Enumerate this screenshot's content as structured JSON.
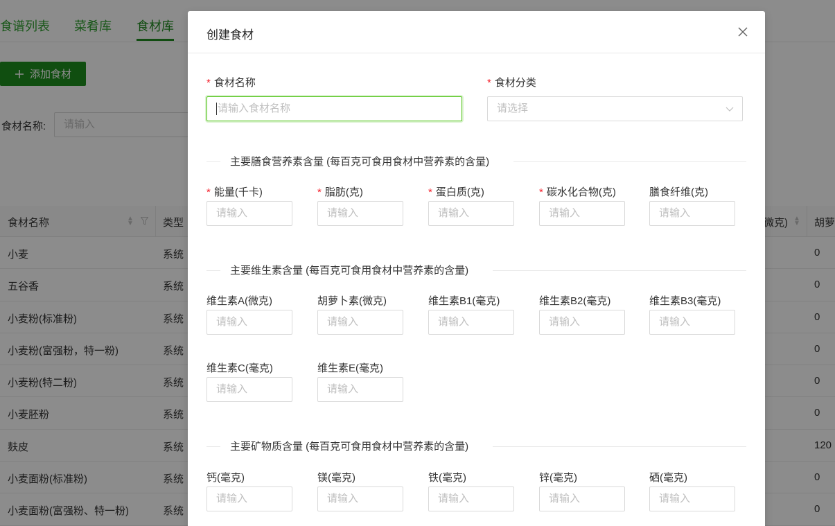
{
  "tabs": [
    {
      "label": "食谱列表"
    },
    {
      "label": "菜肴库"
    },
    {
      "label": "食材库"
    }
  ],
  "toolbar": {
    "add_label": "添加食材",
    "add_icon": "plus-icon"
  },
  "search": {
    "label": "食材名称:",
    "placeholder": "请输入"
  },
  "table": {
    "col_name": "食材名称",
    "col_type": "类型",
    "col_right_partial": "微克)",
    "col_far_right": "胡萝",
    "rows": [
      {
        "name": "小麦",
        "type": "系统",
        "right": "0"
      },
      {
        "name": "五谷香",
        "type": "系统",
        "right": "0"
      },
      {
        "name": "小麦粉(标准粉)",
        "type": "系统",
        "right": "0"
      },
      {
        "name": "小麦粉(富强粉，特一粉)",
        "type": "系统",
        "right": "0"
      },
      {
        "name": "小麦粉(特二粉)",
        "type": "系统",
        "right": "0"
      },
      {
        "name": "小麦胚粉",
        "type": "系统",
        "right": "0"
      },
      {
        "name": "麸皮",
        "type": "系统",
        "right": "120"
      },
      {
        "name": "小麦面粉(标准粉)",
        "type": "系统",
        "right": "0"
      },
      {
        "name": "小麦面粉(富强粉、特一粉)",
        "type": "系统",
        "right": "0"
      }
    ]
  },
  "modal": {
    "title": "创建食材",
    "name_label": "食材名称",
    "name_placeholder": "请输入食材名称",
    "category_label": "食材分类",
    "category_placeholder": "请选择",
    "section1": "主要膳食营养素含量 (每百克可食用食材中营养素的含量)",
    "section2": "主要维生素含量 (每百克可食用食材中营养素的含量)",
    "section3": "主要矿物质含量 (每百克可食用食材中营养素的含量)",
    "input_placeholder": "请输入",
    "macros": [
      {
        "label": "能量(千卡)",
        "required": true
      },
      {
        "label": "脂肪(克)",
        "required": true
      },
      {
        "label": "蛋白质(克)",
        "required": true
      },
      {
        "label": "碳水化合物(克)",
        "required": true
      },
      {
        "label": "膳食纤维(克)",
        "required": false
      }
    ],
    "vitamins": [
      {
        "label": "维生素A(微克)"
      },
      {
        "label": "胡萝卜素(微克)"
      },
      {
        "label": "维生素B1(毫克)"
      },
      {
        "label": "维生素B2(毫克)"
      },
      {
        "label": "维生素B3(毫克)"
      },
      {
        "label": "维生素C(毫克)"
      },
      {
        "label": "维生素E(毫克)"
      }
    ],
    "minerals": [
      {
        "label": "钙(毫克)"
      },
      {
        "label": "镁(毫克)"
      },
      {
        "label": "铁(毫克)"
      },
      {
        "label": "锌(毫克)"
      },
      {
        "label": "硒(毫克)"
      }
    ]
  },
  "colors": {
    "primary": "#1e8f1e",
    "required": "#f5222d",
    "focus": "#52c41a"
  }
}
